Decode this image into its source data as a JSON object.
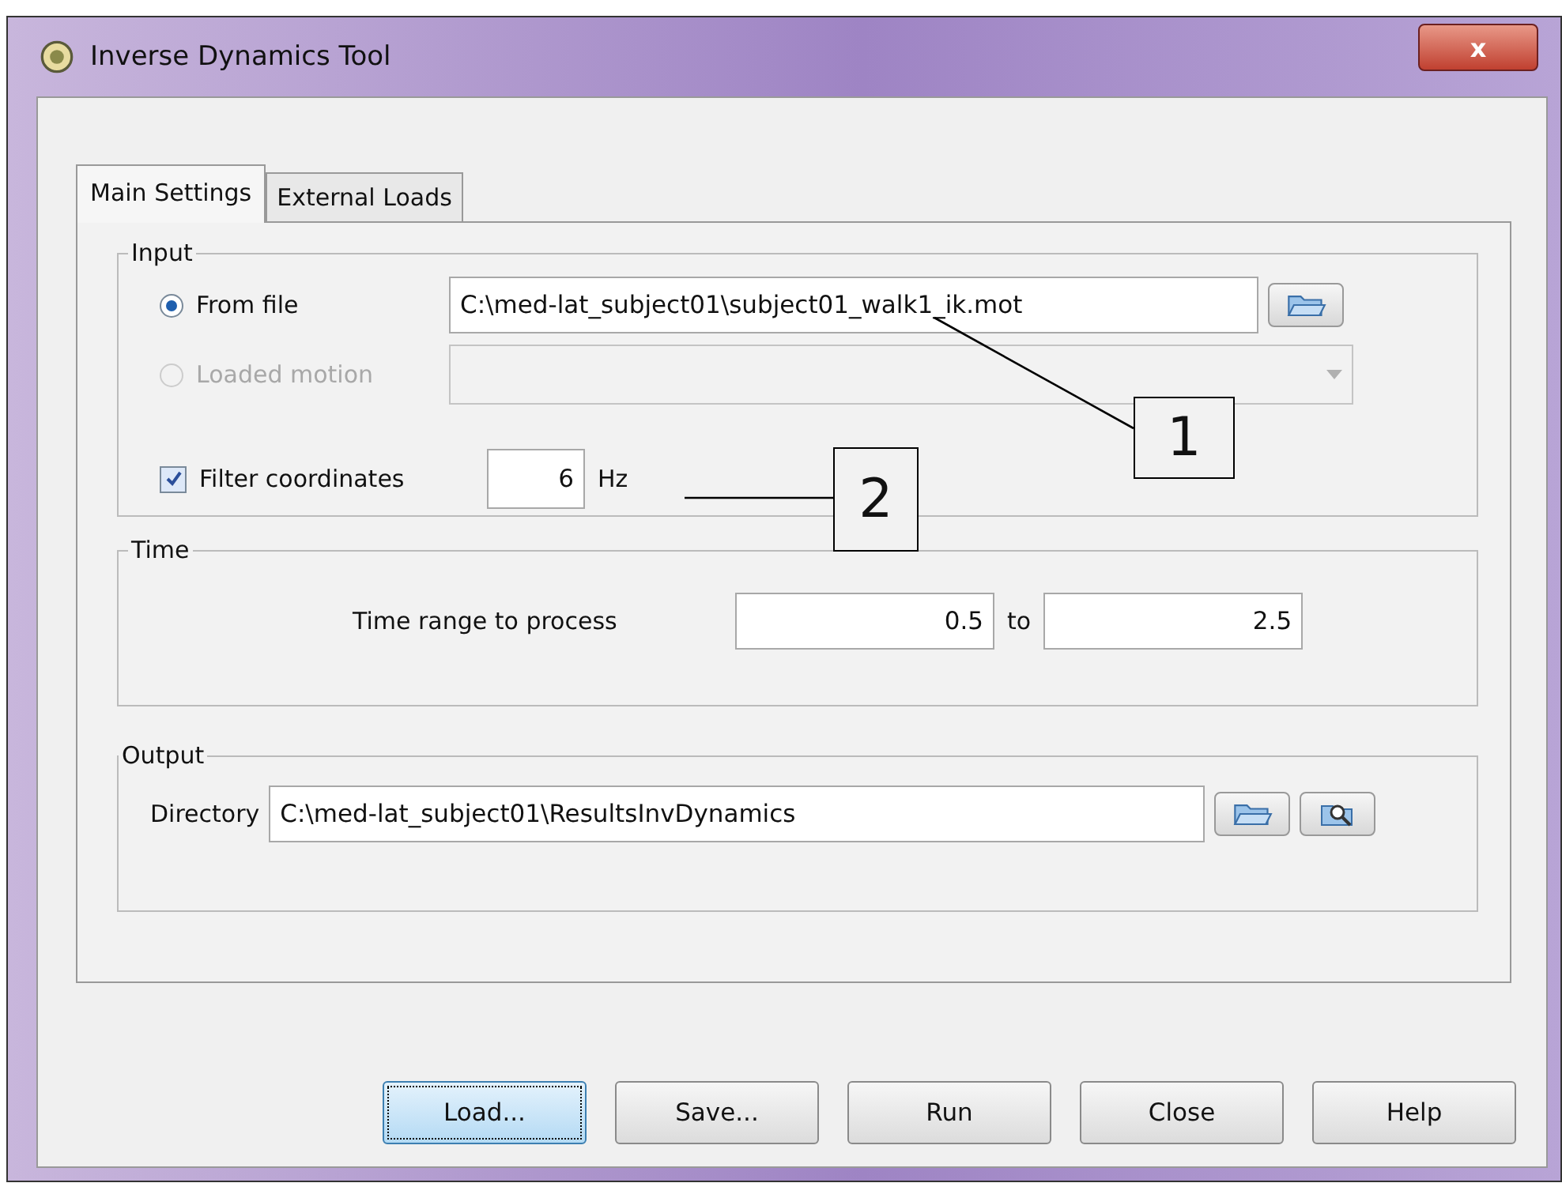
{
  "window": {
    "title": "Inverse Dynamics Tool",
    "close_label": "x"
  },
  "tabs": [
    {
      "label": "Main Settings",
      "selected": true
    },
    {
      "label": "External Loads",
      "selected": false
    }
  ],
  "input": {
    "title": "Input",
    "sources": [
      {
        "kind": "file",
        "label": "From file",
        "selected": true,
        "disabled": false,
        "value": "C:\\med-lat_subject01\\subject01_walk1_ik.mot"
      },
      {
        "kind": "dropdown",
        "label": "Loaded motion",
        "selected": false,
        "disabled": true
      }
    ],
    "filter": {
      "label": "Filter coordinates",
      "checked": true,
      "value": "6",
      "unit": "Hz"
    }
  },
  "time": {
    "title": "Time",
    "label": "Time range to process",
    "from": "0.5",
    "separator": "to",
    "to": "2.5"
  },
  "output": {
    "title": "Output",
    "label": "Directory",
    "value": "C:\\med-lat_subject01\\ResultsInvDynamics"
  },
  "annotations": [
    {
      "label": "1"
    },
    {
      "label": "2"
    }
  ],
  "buttons": [
    {
      "label": "Load...",
      "focused": true
    },
    {
      "label": "Save...",
      "focused": false
    },
    {
      "label": "Run",
      "focused": false
    },
    {
      "label": "Close",
      "focused": false
    },
    {
      "label": "Help",
      "focused": false
    }
  ]
}
